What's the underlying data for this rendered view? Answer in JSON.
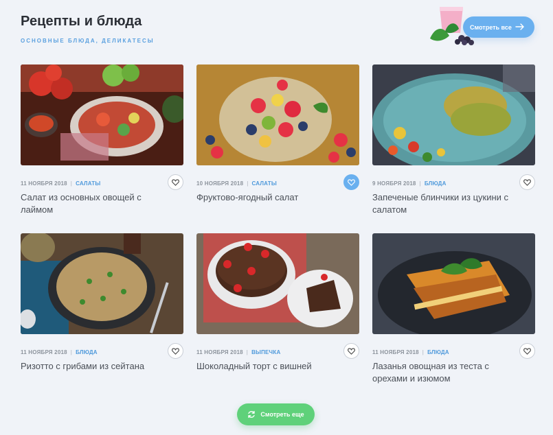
{
  "header": {
    "title": "Рецепты и блюда",
    "subtitle": "ОСНОВНЫЕ БЛЮДА, ДЕЛИКАТЕСЫ",
    "see_all_label": "Смотреть все",
    "see_all_color": "#6ab0ef",
    "accent_color": "#5aa0df"
  },
  "recipes": [
    {
      "date": "11 НОЯБРЯ 2018",
      "category": "САЛАТЫ",
      "title": "Салат из основных овощей с лаймом",
      "liked": false,
      "image": "vegetable-salad-image"
    },
    {
      "date": "10 НОЯБРЯ 2018",
      "category": "САЛАТЫ",
      "title": "Фруктово-ягодный салат",
      "liked": true,
      "image": "fruit-berry-salad-image"
    },
    {
      "date": "9 НОЯБРЯ 2018",
      "category": "БЛЮДА",
      "title": "Запеченые блинчики из цукини с салатом",
      "liked": false,
      "image": "zucchini-pancakes-image"
    },
    {
      "date": "11 НОЯБРЯ 2018",
      "category": "БЛЮДА",
      "title": "Ризотто с грибами из сейтана",
      "liked": false,
      "image": "risotto-image"
    },
    {
      "date": "11 НОЯБРЯ 2018",
      "category": "ВЫПЕЧКА",
      "title": "Шоколадный торт с вишней",
      "liked": false,
      "image": "chocolate-cake-image"
    },
    {
      "date": "11 НОЯБРЯ 2018",
      "category": "БЛЮДА",
      "title": "Лазанья овощная из теста с орехами и изюмом",
      "liked": false,
      "image": "lasagna-image"
    }
  ],
  "footer": {
    "load_more_label": "Смотреть еще",
    "load_more_color": "#5fd17a"
  }
}
